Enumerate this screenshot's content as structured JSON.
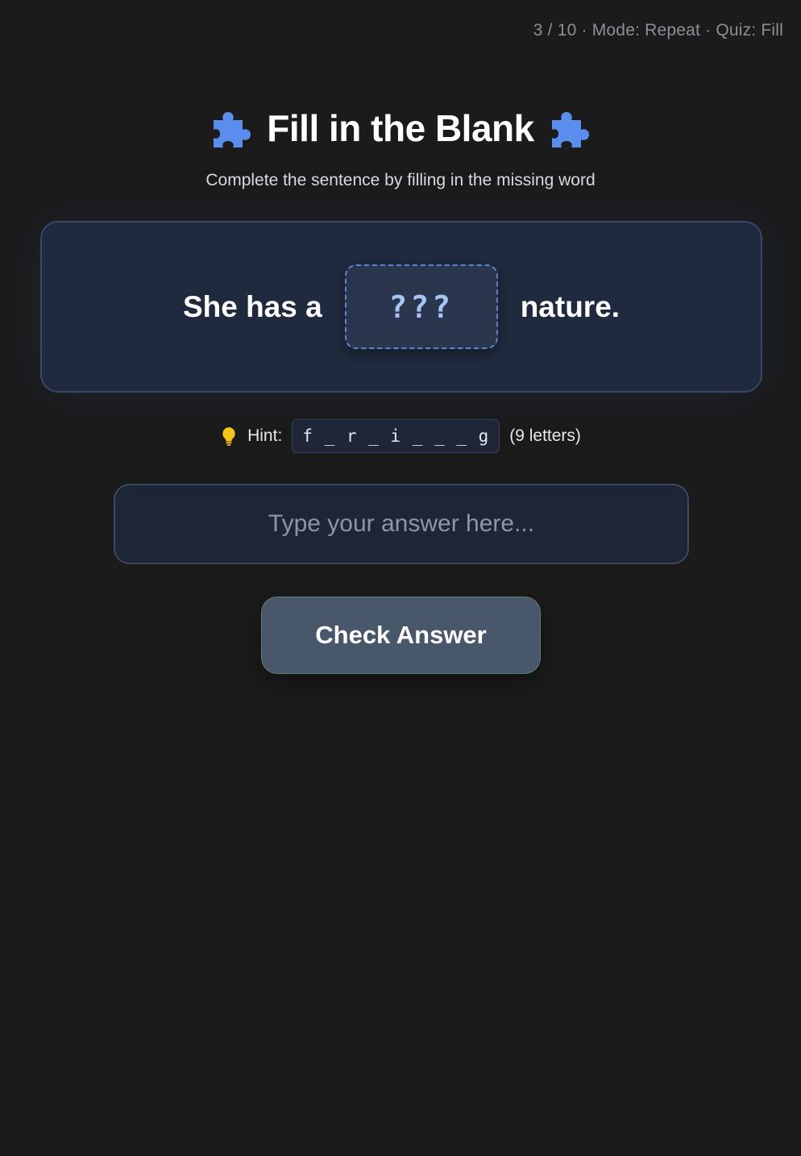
{
  "header": {
    "progress": "3 / 10 · Mode: Repeat · Quiz: Fill"
  },
  "quiz": {
    "title": "Fill in the Blank",
    "subtitle": "Complete the sentence by filling in the missing word",
    "sentence_before": "She has a",
    "blank_placeholder": "???",
    "sentence_after": "nature.",
    "icon": "puzzle-piece-icon",
    "accent_color": "#5b8def"
  },
  "hint": {
    "label": "Hint:",
    "pattern": "f _ r _ i _ _ _ g",
    "length_text": "(9 letters)",
    "icon": "lightbulb-icon"
  },
  "answer": {
    "value": "",
    "placeholder": "Type your answer here..."
  },
  "actions": {
    "check_label": "Check Answer"
  }
}
